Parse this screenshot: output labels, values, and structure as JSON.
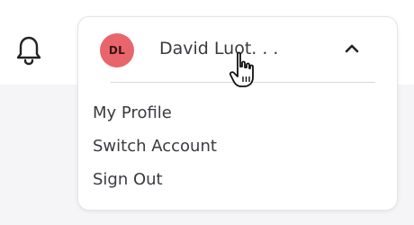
{
  "header": {
    "notification_icon": "bell-icon"
  },
  "user_menu": {
    "avatar_initials": "DL",
    "avatar_color": "#e8666b",
    "user_name": "David Luot. . .",
    "toggle_icon": "chevron-up-icon",
    "items": [
      {
        "label": "My Profile"
      },
      {
        "label": "Switch Account"
      },
      {
        "label": "Sign Out"
      }
    ]
  },
  "cursor_icon": "hand-pointer-icon"
}
